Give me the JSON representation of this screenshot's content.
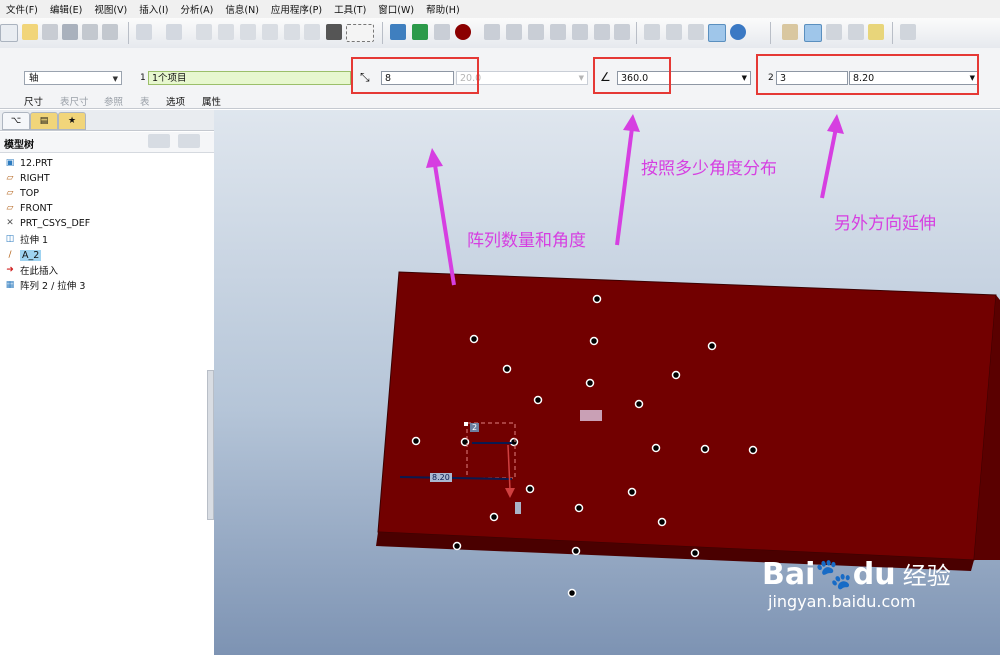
{
  "menu": [
    "文件(F)",
    "编辑(E)",
    "视图(V)",
    "插入(I)",
    "分析(A)",
    "信息(N)",
    "应用程序(P)",
    "工具(T)",
    "窗口(W)",
    "帮助(H)"
  ],
  "dashboard": {
    "pattern_type": "轴",
    "first_dir_num": "1",
    "first_ref": "1个项目",
    "count": "8",
    "count_angle": "20.0",
    "total_angle": "360.0",
    "second_dir_num": "2",
    "second_count": "3",
    "second_spacing": "8.20",
    "tabs": [
      "尺寸",
      "表尺寸",
      "参照",
      "表",
      "选项",
      "属性"
    ]
  },
  "model_tree": {
    "title": "模型树",
    "items": [
      {
        "label": "12.PRT",
        "icon": "part-icon"
      },
      {
        "label": "RIGHT",
        "icon": "datum-plane-icon"
      },
      {
        "label": "TOP",
        "icon": "datum-plane-icon"
      },
      {
        "label": "FRONT",
        "icon": "datum-plane-icon"
      },
      {
        "label": "PRT_CSYS_DEF",
        "icon": "csys-icon"
      },
      {
        "label": "拉伸 1",
        "icon": "extrude-icon"
      },
      {
        "label": "A_2",
        "icon": "axis-icon"
      },
      {
        "label": "在此插入",
        "icon": "insert-arrow-icon"
      },
      {
        "label": "阵列 2 / 拉伸 3",
        "icon": "pattern-icon"
      }
    ]
  },
  "annotations": {
    "count_angle": "阵列数量和角度",
    "total_angle": "按照多少角度分布",
    "other_direction": "另外方向延伸"
  },
  "viewport": {
    "dim_label": "8.20",
    "dim_count": "2",
    "plate_color": "#720000",
    "plate_side": "#4a0000"
  },
  "watermark": {
    "brand": "Bai",
    "brand2": "du",
    "cn": "经验",
    "url": "jingyan.baidu.com"
  },
  "colors": {
    "annotation": "#d63fe1",
    "highlight_box": "#e53935"
  }
}
